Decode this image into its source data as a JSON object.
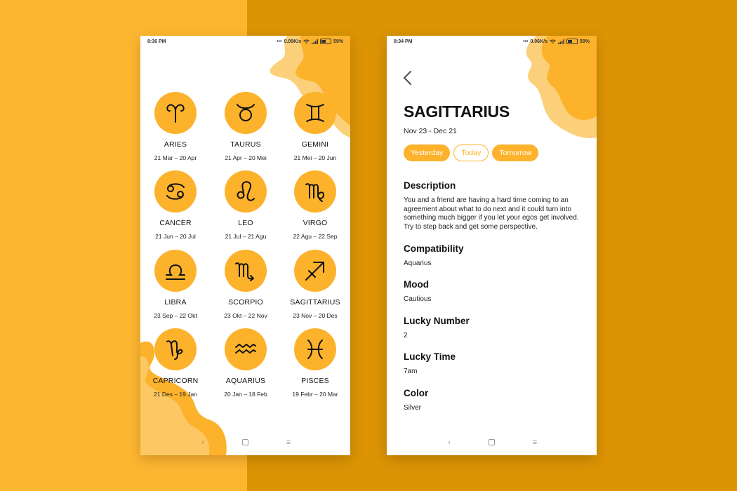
{
  "colors": {
    "accent": "#fdb22c",
    "left_bg": "#fdb630",
    "right_bg": "#dc9405"
  },
  "list_screen": {
    "status_time": "8:36 PM",
    "status_speed": "0.09K/s",
    "status_battery": "59%",
    "signs": [
      {
        "icon": "aries-icon",
        "name": "ARIES",
        "dates": "21 Mar – 20 Apr"
      },
      {
        "icon": "taurus-icon",
        "name": "TAURUS",
        "dates": "21 Apr – 20 Mei"
      },
      {
        "icon": "gemini-icon",
        "name": "GEMINI",
        "dates": "21 Mei – 20 Jun"
      },
      {
        "icon": "cancer-icon",
        "name": "CANCER",
        "dates": "21 Jun – 20 Jul"
      },
      {
        "icon": "leo-icon",
        "name": "LEO",
        "dates": "21 Jul – 21 Agu"
      },
      {
        "icon": "virgo-icon",
        "name": "VIRGO",
        "dates": "22 Agu – 22 Sep"
      },
      {
        "icon": "libra-icon",
        "name": "LIBRA",
        "dates": "23 Sep – 22 Okt"
      },
      {
        "icon": "scorpio-icon",
        "name": "SCORPIO",
        "dates": "23 Okt – 22 Nov"
      },
      {
        "icon": "sagittarius-icon",
        "name": "SAGITTARIUS",
        "dates": "23 Nov – 20 Des"
      },
      {
        "icon": "capricorn-icon",
        "name": "CAPRICORN",
        "dates": "21 Des – 19 Jan"
      },
      {
        "icon": "aquarius-icon",
        "name": "AQUARIUS",
        "dates": "20 Jan – 18 Feb"
      },
      {
        "icon": "pisces-icon",
        "name": "PISCES",
        "dates": "19 Febr – 20 Mar"
      }
    ]
  },
  "detail_screen": {
    "status_time": "8:34 PM",
    "status_speed": "0.06K/s",
    "status_battery": "59%",
    "title": "SAGITTARIUS",
    "date_range": "Nov 23 - Dec 21",
    "tabs": [
      {
        "label": "Yesterday",
        "style": "filled"
      },
      {
        "label": "Today",
        "style": "outline"
      },
      {
        "label": "Tomorrow",
        "style": "filled"
      }
    ],
    "sections": [
      {
        "heading": "Description",
        "value": "You and a friend are having a hard time coming to an agreement about what to do next and it could turn into something much bigger if you let your egos get involved. Try to step back and get some perspective."
      },
      {
        "heading": "Compatibility",
        "value": "Aquarius"
      },
      {
        "heading": "Mood",
        "value": "Cautious"
      },
      {
        "heading": "Lucky Number",
        "value": "2"
      },
      {
        "heading": "Lucky Time",
        "value": "7am"
      },
      {
        "heading": "Color",
        "value": "Silver"
      }
    ]
  }
}
